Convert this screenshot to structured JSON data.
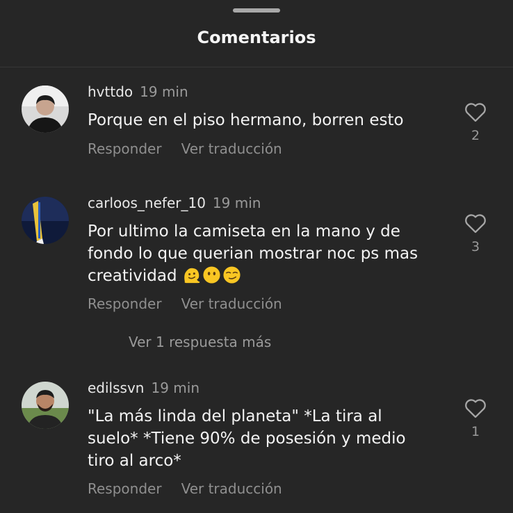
{
  "sheet": {
    "title": "Comentarios"
  },
  "comments": [
    {
      "username": "hvttdo",
      "time": "19 min",
      "text": "Porque en el piso hermano, borren esto",
      "reply_label": "Responder",
      "translate_label": "Ver traducción",
      "likes": "2"
    },
    {
      "username": "carloos_nefer_10",
      "time": "19 min",
      "text": "Por ultimo la camiseta en la mano y de fondo lo que querian mostrar noc ps mas creatividad",
      "emojis": [
        "melting-face-emoji",
        "face-without-mouth-emoji",
        "smirking-face-emoji"
      ],
      "reply_label": "Responder",
      "translate_label": "Ver traducción",
      "likes": "3",
      "more_replies": "Ver 1 respuesta más"
    },
    {
      "username": "edilssvn",
      "time": "19 min",
      "text": "\"La más linda del planeta\" *La tira al suelo* *Tiene 90% de posesión y medio tiro al arco*",
      "reply_label": "Responder",
      "translate_label": "Ver traducción",
      "likes": "1"
    }
  ],
  "colors": {
    "background": "#262626",
    "primary_text": "#f3f3f3",
    "secondary_text": "#9a9a9a",
    "divider": "#363636",
    "emoji_yellow": "#f9c623"
  }
}
